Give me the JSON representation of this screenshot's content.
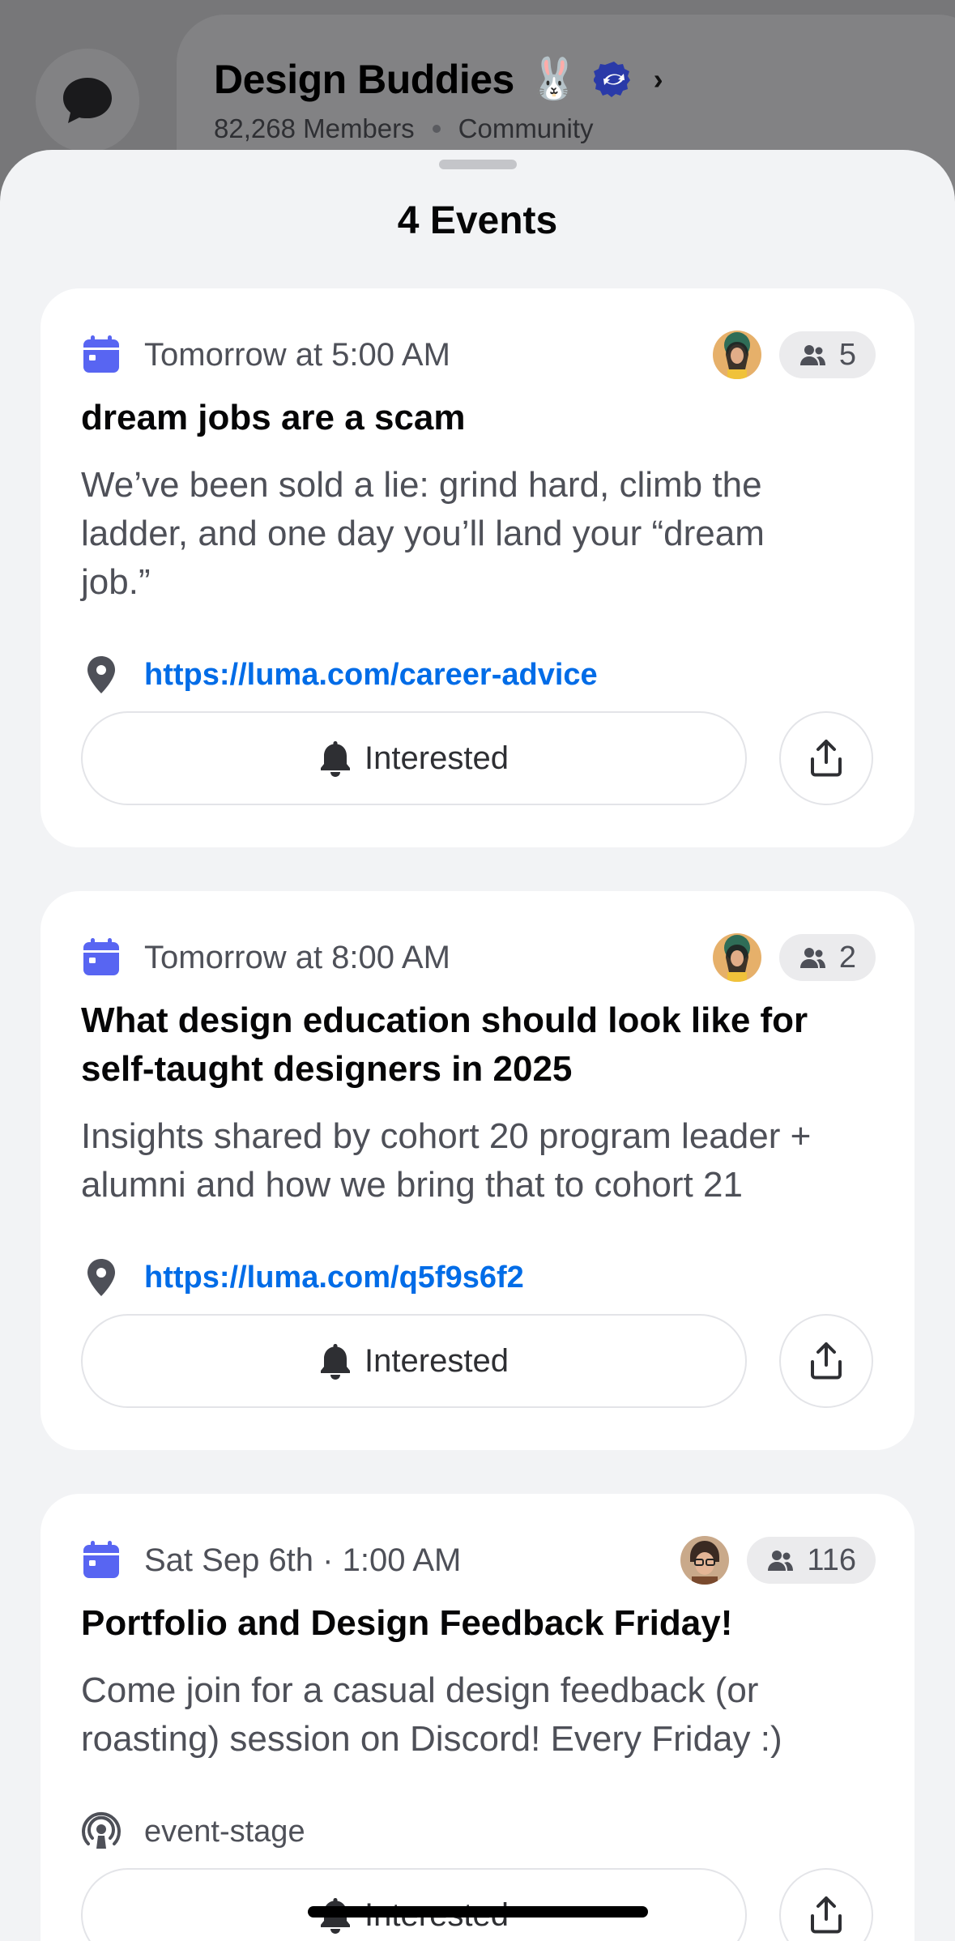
{
  "server": {
    "name": "Design Buddies",
    "emoji": "🐰",
    "members": "82,268 Members",
    "type": "Community"
  },
  "sheet": {
    "title": "4 Events"
  },
  "events": [
    {
      "time": "Tomorrow at 5:00 AM",
      "count": "5",
      "title_lines": [
        "dream jobs are a scam"
      ],
      "desc_lines": [
        "We’ve been sold a lie: grind hard, climb the",
        "ladder, and one day you’ll land your “dream",
        "job.”"
      ],
      "location": "https://luma.com/career-advice",
      "location_type": "link",
      "interested_label": "Interested"
    },
    {
      "time": "Tomorrow at 8:00 AM",
      "count": "2",
      "title_lines": [
        "What design education should look like for",
        "self-taught designers in 2025"
      ],
      "desc_lines": [
        "Insights shared by cohort 20 program leader +",
        "alumni and how we bring that to cohort 21"
      ],
      "location": "https://luma.com/q5f9s6f2",
      "location_type": "link",
      "interested_label": "Interested"
    },
    {
      "time": "Sat Sep 6th · 1:00 AM",
      "count": "116",
      "title_lines": [
        "Portfolio and Design Feedback Friday!"
      ],
      "desc_lines": [
        "Come join for a casual design feedback (or",
        "roasting) session on Discord! Every Friday :)"
      ],
      "location": "event-stage",
      "location_type": "stage",
      "interested_label": "Interested"
    }
  ],
  "colors": {
    "accent": "#5865f2",
    "link": "#006ce7"
  }
}
